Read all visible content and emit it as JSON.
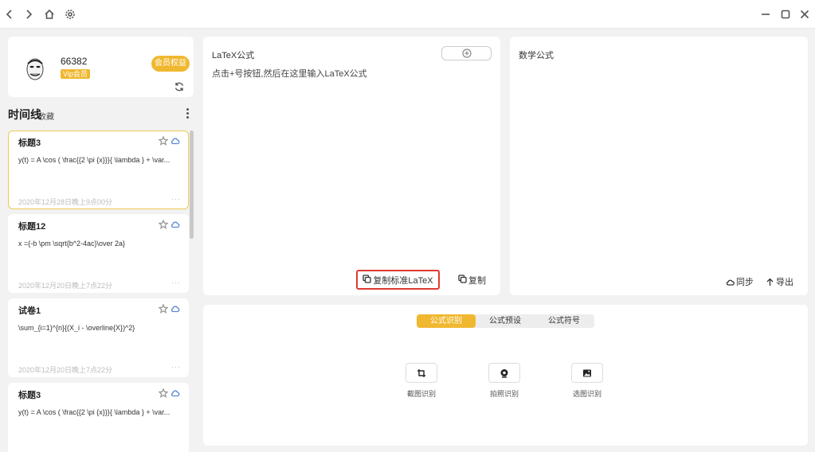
{
  "titlebar": {
    "back_icon": "chevron-left-icon",
    "forward_icon": "chevron-right-icon",
    "home_icon": "home-icon",
    "settings_icon": "gear-icon",
    "minimize_icon": "minimize-icon",
    "maximize_icon": "maximize-icon",
    "close_icon": "close-icon"
  },
  "user": {
    "name": "66382",
    "vip_label": "Vip会员",
    "member_button": "会员权益"
  },
  "timeline": {
    "title": "时间线",
    "favorites": "收藏",
    "cards": [
      {
        "title": "标题3",
        "formula": "y(t) = A \\cos ( \\frac{{2 \\pi {x}}}{ \\lambda } + \\var...",
        "date": "2020年12月28日晚上9点00分",
        "more": "···"
      },
      {
        "title": "标题12",
        "formula": "x ={-b \\pm \\sqrt{b^2-4ac}\\over 2a}",
        "date": "2020年12月20日晚上7点22分",
        "more": "···"
      },
      {
        "title": "试卷1",
        "formula": "\\sum_{i=1}^{n}{(X_i - \\overline{X})^2}",
        "date": "2020年12月20日晚上7点22分",
        "more": "···"
      },
      {
        "title": "标题3",
        "formula": "y(t) = A \\cos ( \\frac{{2 \\pi {x}}}{ \\lambda } + \\var...",
        "date": "",
        "more": ""
      }
    ]
  },
  "latex_panel": {
    "title": "LaTeX公式",
    "placeholder": "点击+号按钮,然后在这里输入LaTeX公式",
    "value": "",
    "copy_standard": "复制标准LaTeX",
    "copy": "复制"
  },
  "math_panel": {
    "title": "数学公式",
    "sync": "同步",
    "export": "导出"
  },
  "bottom_panel": {
    "tabs": [
      {
        "label": "公式识别",
        "active": true
      },
      {
        "label": "公式预设",
        "active": false
      },
      {
        "label": "公式符号",
        "active": false
      }
    ],
    "tools": [
      {
        "label": "截图识别",
        "icon": "crop-icon"
      },
      {
        "label": "拍照识别",
        "icon": "camera-icon"
      },
      {
        "label": "选图识别",
        "icon": "image-icon"
      }
    ]
  },
  "colors": {
    "accent": "#f0b830",
    "highlight_border": "#e03a32",
    "cloud": "#5a8ad8",
    "background": "#f2f2f2"
  }
}
